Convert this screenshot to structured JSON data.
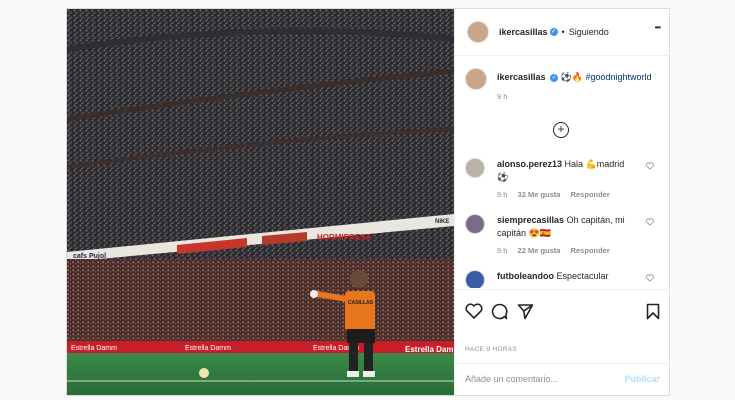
{
  "post": {
    "author": "ikercasillas",
    "follow_status": "Siguiendo",
    "dot": "•",
    "more": "•••",
    "caption_emojis": "⚽🔥",
    "caption_hashtag": "#goodnightworld",
    "caption_time": "9 h",
    "load_more": "+"
  },
  "comments": [
    {
      "user": "alonso.perez13",
      "text": "Hala 💪madrid ⚽",
      "time": "9 h",
      "likes": "32 Me gusta",
      "reply": "Responder"
    },
    {
      "user": "siemprecasillas",
      "text": "Oh capitán, mi capitán 😍🇪🇸",
      "time": "9 h",
      "likes": "22 Me gusta",
      "reply": "Responder"
    },
    {
      "user": "futboleandoo",
      "text": "Espectacular"
    }
  ],
  "actions": {
    "timeline": "HACE 9 HORAS",
    "comment_placeholder": "Añade un comentario...",
    "publish": "Publicar"
  },
  "photo": {
    "banners": [
      "cafs Pujol",
      "HORMIPRESA",
      "NIKE",
      "Estrella Damm",
      "Estrella Damm",
      "Estrella Damm",
      "Estrella Damm",
      "CASILLAS"
    ]
  },
  "colors": {
    "accent": "#3897f0",
    "keeper_shirt": "#e8761f",
    "pitch": "#2f7d3f"
  }
}
